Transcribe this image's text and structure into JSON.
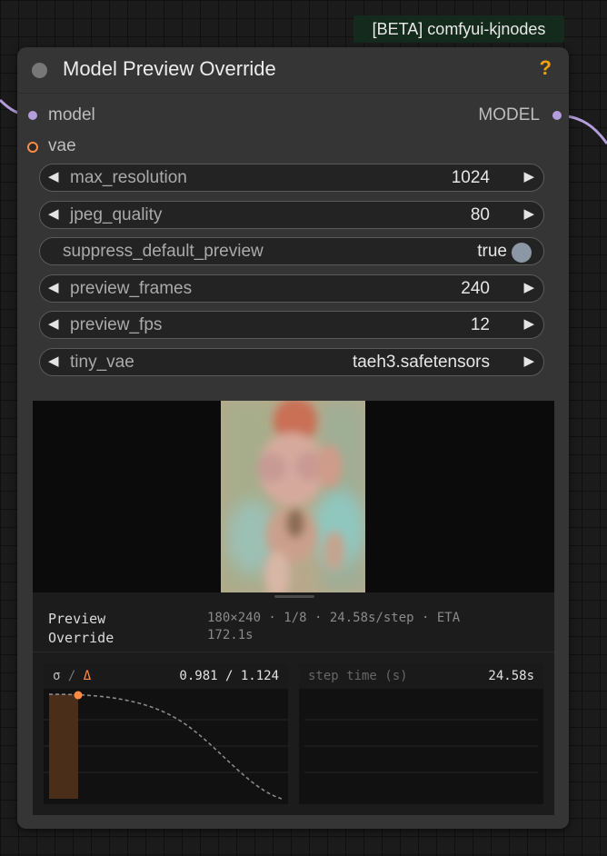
{
  "badge": "[BETA] comfyui-kjnodes",
  "node": {
    "title": "Model Preview Override",
    "help": "?",
    "inputs": [
      {
        "label": "model",
        "color": "#b39ddb"
      },
      {
        "label": "vae",
        "color": "#ff8c42"
      }
    ],
    "output": {
      "label": "MODEL",
      "color": "#b39ddb"
    }
  },
  "widgets": [
    {
      "label": "max_resolution",
      "value": "1024"
    },
    {
      "label": "jpeg_quality",
      "value": "80"
    },
    {
      "label": "suppress_default_preview",
      "value": "true"
    },
    {
      "label": "preview_frames",
      "value": "240"
    },
    {
      "label": "preview_fps",
      "value": "12"
    },
    {
      "label": "tiny_vae",
      "value": "taeh3.safetensors"
    }
  ],
  "preview": {
    "label_line1": "Preview",
    "label_line2": "Override",
    "stats_line1": "180×240 · 1/8 · 24.58s/step · ETA",
    "stats_line2": "172.1s"
  },
  "sigma_chart": {
    "sigma_symbol": "σ",
    "sep": " / ",
    "delta_symbol": "Δ",
    "value": "0.981 / 1.124",
    "progress_fraction": 0.125
  },
  "step_chart": {
    "label": "step time (s)",
    "value": "24.58s"
  },
  "colors": {
    "accent_orange": "#ff8c42",
    "help": "#f1a10f",
    "wire": "#b39ddb"
  }
}
